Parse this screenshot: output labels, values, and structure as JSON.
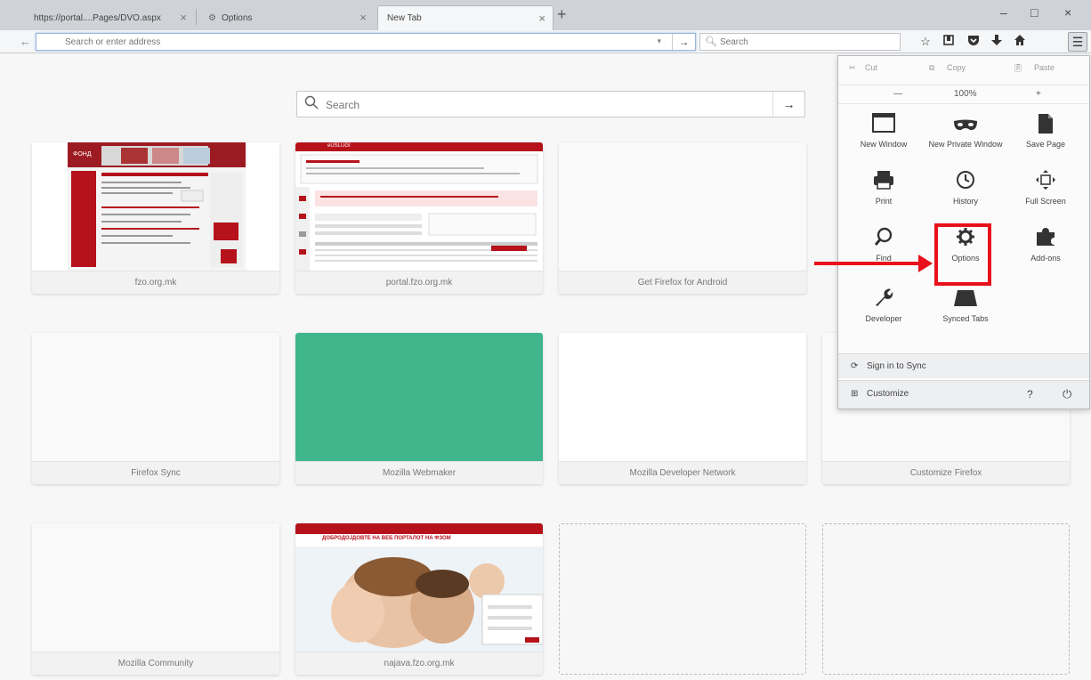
{
  "tabs": [
    {
      "title": "https://portal....Pages/DVO.aspx",
      "close": "×"
    },
    {
      "title": "Options",
      "close": "×"
    },
    {
      "title": "New Tab",
      "close": "×"
    }
  ],
  "window": {
    "new_tab": "+",
    "minimize": "–",
    "maximize": "□",
    "close": "×"
  },
  "navbar": {
    "back": "←",
    "url_placeholder": "Search or enter address",
    "url_dropdown": "▾",
    "url_go": "→",
    "search_placeholder": "Search"
  },
  "newtab": {
    "search_placeholder": "Search",
    "search_go": "→"
  },
  "tiles": [
    {
      "label": "fzo.org.mk"
    },
    {
      "label": "portal.fzo.org.mk"
    },
    {
      "label": "Get Firefox for Android"
    },
    {
      "label": "Firefox Sync"
    },
    {
      "label": "Mozilla Webmaker"
    },
    {
      "label": "Mozilla Developer Network"
    },
    {
      "label": "Customize Firefox"
    },
    {
      "label": "Mozilla Community"
    },
    {
      "label": "najava.fzo.org.mk"
    }
  ],
  "thumbs": {
    "t1_text": "ФОНД",
    "t2_text": "eUSLUGI",
    "t9_banner": "ДОБРОДОЈДОВТЕ НА ВЕБ ПОРТАЛОТ НА ФЗОМ"
  },
  "menu": {
    "cut": "Cut",
    "copy": "Copy",
    "paste": "Paste",
    "zoom_out": "—",
    "zoom_level": "100%",
    "zoom_in": "+",
    "items": [
      {
        "label": "New Window",
        "icon": "new-window-icon"
      },
      {
        "label": "New Private Window",
        "icon": "private-mask-icon"
      },
      {
        "label": "Save Page",
        "icon": "save-page-icon"
      },
      {
        "label": "Print",
        "icon": "print-icon"
      },
      {
        "label": "History",
        "icon": "history-clock-icon"
      },
      {
        "label": "Full Screen",
        "icon": "full-screen-icon"
      },
      {
        "label": "Find",
        "icon": "find-magnifier-icon"
      },
      {
        "label": "Options",
        "icon": "options-gear-icon"
      },
      {
        "label": "Add-ons",
        "icon": "add-ons-puzzle-icon"
      },
      {
        "label": "Developer",
        "icon": "developer-wrench-icon"
      },
      {
        "label": "Synced Tabs",
        "icon": "synced-tabs-icon"
      }
    ],
    "sign_in": "Sign in to Sync",
    "customize": "Customize"
  },
  "colors": {
    "annotation_red": "#e8101a",
    "webmaker_green": "#3fb68b",
    "fzo_red": "#b5121b"
  }
}
